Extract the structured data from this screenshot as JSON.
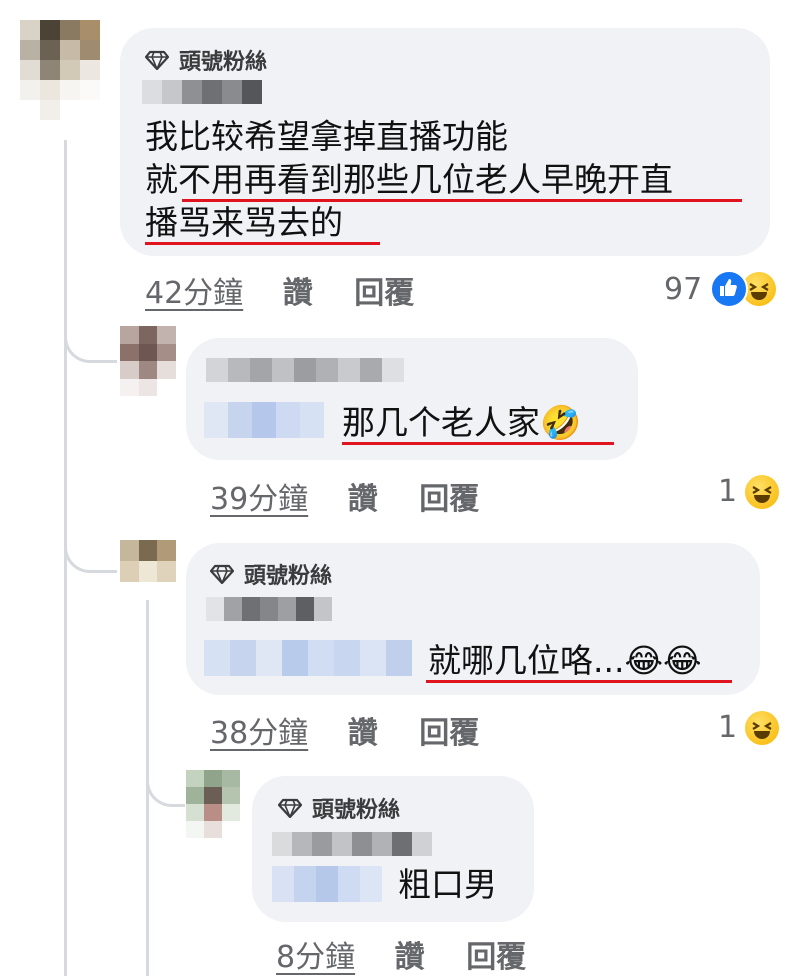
{
  "comments": [
    {
      "badge": "頭號粉絲",
      "lines": [
        "我比较希望拿掉直播功能",
        "就不用再看到那些几位老人早晚开直",
        "播骂来骂去的"
      ],
      "time": "42分鐘",
      "like": "讚",
      "reply": "回覆",
      "reaction_count": "97",
      "reaction_icons": [
        "like-icon",
        "laugh-emoji-icon"
      ]
    },
    {
      "badge": "",
      "text": "那几个老人家🤣",
      "time": "39分鐘",
      "like": "讚",
      "reply": "回覆",
      "reaction_count": "1",
      "reaction_icons": [
        "laugh-emoji-icon"
      ]
    },
    {
      "badge": "頭號粉絲",
      "text": "就哪几位咯...😂😂",
      "time": "38分鐘",
      "like": "讚",
      "reply": "回覆",
      "reaction_count": "1",
      "reaction_icons": [
        "laugh-emoji-icon"
      ]
    },
    {
      "badge": "頭號粉絲",
      "text": "粗口男",
      "time": "8分鐘",
      "like": "讚",
      "reply": "回覆"
    }
  ],
  "colors": {
    "bubble": "#f0f2f5",
    "underline": "#e0141e",
    "meta": "#65676b",
    "thread": "#d6d9dd"
  }
}
